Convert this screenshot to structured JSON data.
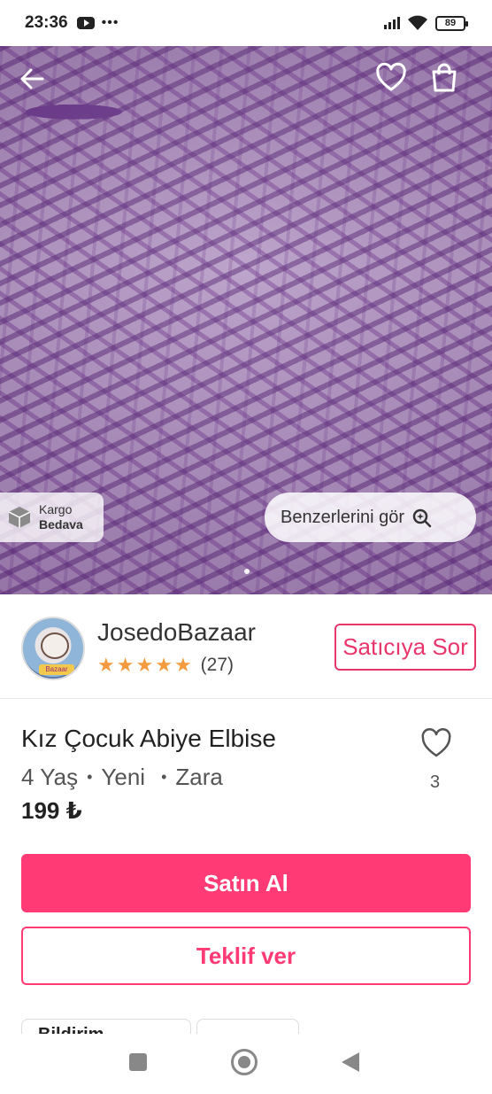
{
  "status_bar": {
    "time": "23:36",
    "dots": "•••",
    "battery": "89",
    "icons": [
      "youtube-icon",
      "signal-icon",
      "wifi-icon",
      "battery-icon"
    ]
  },
  "hero": {
    "back_icon": "arrow-left-icon",
    "favorite_icon": "heart-outline-icon",
    "bag_icon": "shopping-bag-icon",
    "cargo": {
      "line1": "Kargo",
      "line2": "Bedava",
      "icon": "box-icon"
    },
    "similar_label": "Benzerlerini gör",
    "similar_icon": "search-sparkle-icon"
  },
  "seller": {
    "name": "JosedoBazaar",
    "stars": 5,
    "rating_count": "(27)",
    "ask_button": "Satıcıya Sor",
    "avatar_tag": "Bazaar"
  },
  "product": {
    "title": "Kız Çocuk Abiye Elbise",
    "size": "4 Yaş",
    "condition": "Yeni",
    "brand": "Zara",
    "separator": "•",
    "price": "199 ₺",
    "like_count": "3"
  },
  "actions": {
    "buy": "Satın Al",
    "offer": "Teklif ver"
  },
  "chips": {
    "first": "Bildirim"
  },
  "colors": {
    "accent": "#ff3a75",
    "star": "#f59b3f",
    "seller_accent": "#e8356b"
  }
}
